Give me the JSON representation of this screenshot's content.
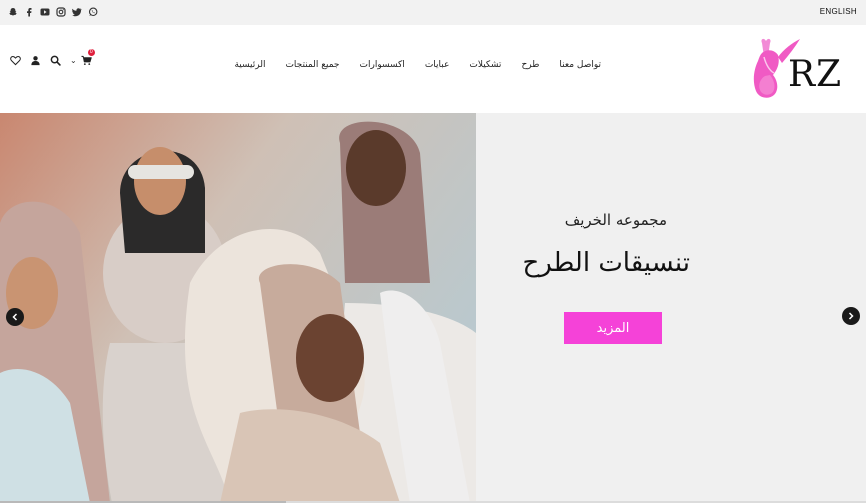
{
  "topbar": {
    "language_label": "ENGLISH",
    "social_icons": [
      "snapchat-icon",
      "facebook-icon",
      "youtube-icon",
      "instagram-icon",
      "twitter-icon",
      "whatsapp-icon"
    ]
  },
  "header": {
    "logo_text": "RZ",
    "cart_count": "0",
    "nav": [
      {
        "label": "الرئيسية"
      },
      {
        "label": "جميع المنتجات"
      },
      {
        "label": "اكسسوارات"
      },
      {
        "label": "عبايات"
      },
      {
        "label": "تشكيلات"
      },
      {
        "label": "طرح"
      },
      {
        "label": "تواصل معنا"
      }
    ],
    "icons": [
      "wishlist-heart-icon",
      "user-icon",
      "search-icon",
      "cart-icon"
    ]
  },
  "hero": {
    "subtitle": "مجموعه الخريف",
    "title": "تنسيقات الطرح",
    "button_label": "المزيد",
    "slider_progress": 0.33
  },
  "colors": {
    "accent": "#f542d8",
    "topbar_bg": "#f2f2f2",
    "hero_bg": "#f0f0f0",
    "logo_pink": "#f05ac4"
  }
}
